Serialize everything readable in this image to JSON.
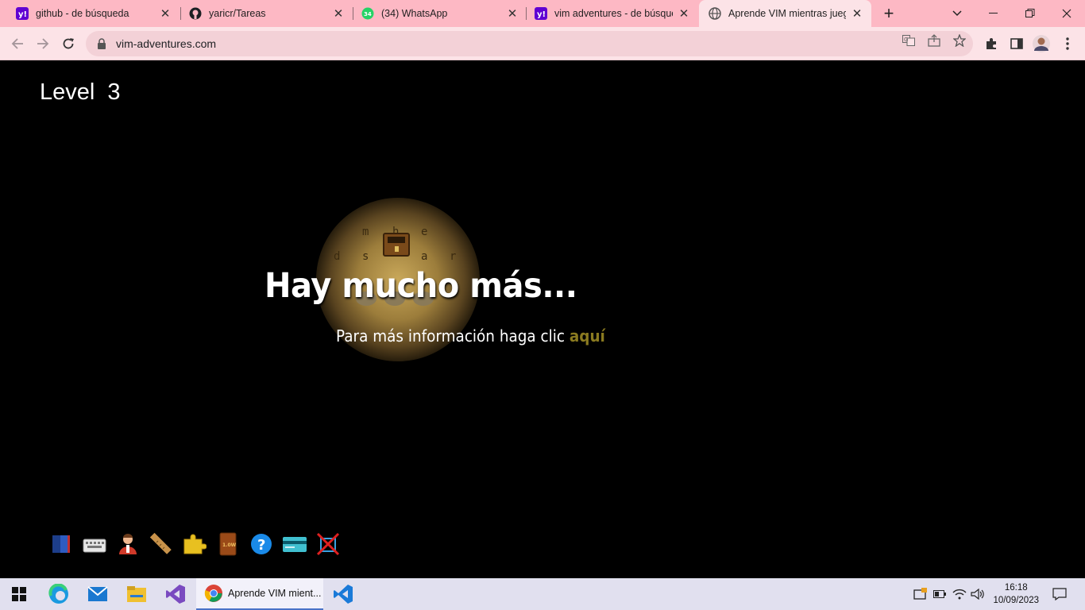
{
  "browser": {
    "tabs": [
      {
        "title": "github - de búsqueda",
        "icon": "yahoo-icon",
        "active": false
      },
      {
        "title": "yaricr/Tareas",
        "icon": "github-icon",
        "active": false
      },
      {
        "title": "(34) WhatsApp",
        "icon": "whatsapp-icon",
        "active": false,
        "badge": "34"
      },
      {
        "title": "vim adventures - de búsqueda",
        "icon": "yahoo-icon",
        "active": false
      },
      {
        "title": "Aprende VIM mientras juegas",
        "icon": "globe-icon",
        "active": true
      }
    ],
    "new_tab_symbol": "+",
    "address": "vim-adventures.com",
    "accent": "#fdb8c4"
  },
  "game": {
    "level_label": "Level",
    "level_number": "3",
    "headline": "Hay mucho más...",
    "subline": "Para más información haga clic",
    "link_text": "aquí",
    "link_color": "#8a7a20",
    "grid_letters": [
      "m",
      "h",
      "e",
      "d",
      "s",
      "a",
      "r"
    ],
    "toolbar_icons": [
      "book-icon",
      "keyboard-icon",
      "user-icon",
      "ruler-icon",
      "puzzle-icon",
      "manual-icon",
      "help-icon",
      "credit-card-icon",
      "mute-icon"
    ],
    "manual_label": "1.0W"
  },
  "taskbar": {
    "active_app_label": "Aprende VIM mient...",
    "time": "16:18",
    "date": "10/09/2023"
  }
}
